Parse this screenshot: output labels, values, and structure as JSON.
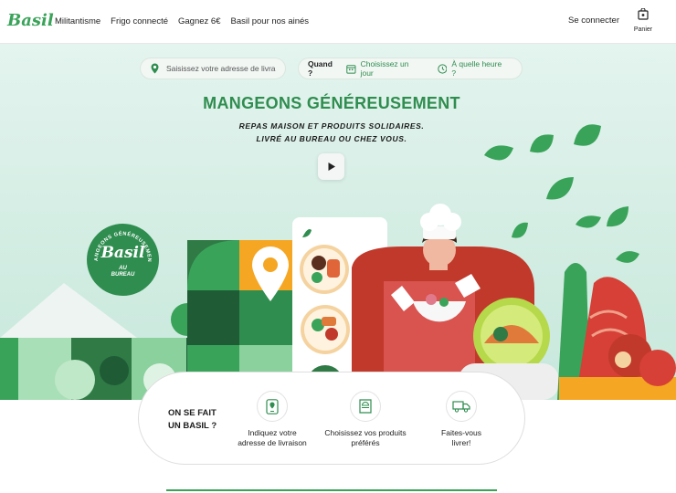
{
  "header": {
    "logo": "Basil",
    "nav": [
      "Militantisme",
      "Frigo connecté",
      "Gagnez 6€",
      "Basil pour nos ainés"
    ],
    "login": "Se connecter",
    "cart_label": "Panier"
  },
  "search": {
    "placeholder": "Saisissez votre adresse de livraison"
  },
  "when": {
    "label": "Quand ?",
    "day": "Choisissez un jour",
    "time": "À quelle heure ?"
  },
  "hero": {
    "title": "MANGEONS GÉNÉREUSEMENT",
    "subtitle_line1": "REPAS MAISON ET PRODUITS SOLIDAIRES.",
    "subtitle_line2": "LIVRÉ AU BUREAU OU CHEZ VOUS."
  },
  "badge": {
    "arc_text": "MANGEONS GÉNÉREUSEMENT",
    "logo": "Basil",
    "sub_line1": "AU",
    "sub_line2": "BUREAU"
  },
  "steps": {
    "title_line1": "ON SE FAIT",
    "title_line2": "UN BASIL ?",
    "items": [
      {
        "icon": "phone-pin-icon",
        "line1": "Indiquez votre",
        "line2": "adresse de livraison"
      },
      {
        "icon": "food-bag-icon",
        "line1": "Choisissez vos produits",
        "line2": "préférés"
      },
      {
        "icon": "delivery-truck-icon",
        "line1": "Faites-vous",
        "line2": "livrer!"
      }
    ]
  },
  "colors": {
    "brand_green": "#2f8d4f",
    "logo_green": "#3aa35a",
    "hero_bg": "#d3ede3",
    "chef_red": "#c0392b",
    "accent_orange": "#f5a623"
  }
}
